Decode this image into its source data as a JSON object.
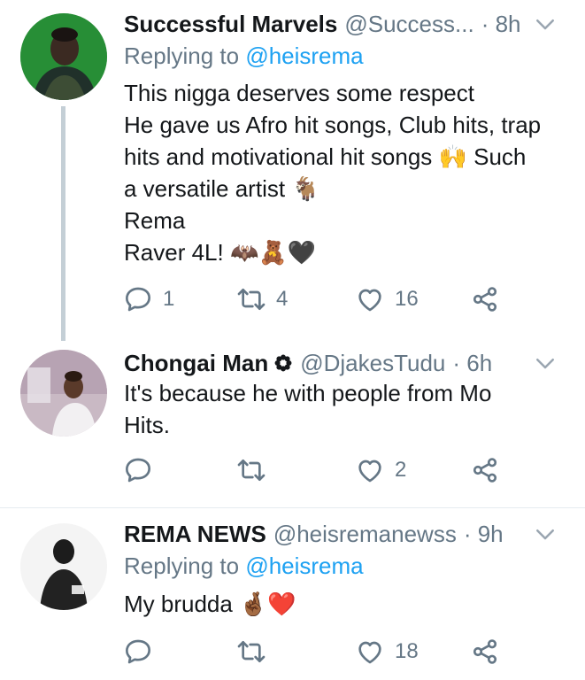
{
  "tweets": [
    {
      "name": "Successful Marvels",
      "handle": "@Success...",
      "time": "· 8h",
      "replying_prefix": "Replying to ",
      "replying_to": "@heisrema",
      "lines": [
        "This nigga deserves some respect",
        "He gave us Afro hit songs, Club hits, trap",
        "hits and motivational hit songs 🙌 Such",
        "a versatile artist 🐐",
        "Rema",
        "Raver 4L! 🦇🧸🖤"
      ],
      "replies": "1",
      "retweets": "4",
      "likes": "16"
    },
    {
      "name": "Chongai Man",
      "badge_icon": "flower-badge-icon",
      "handle": "@DjakesTudu",
      "time": "· 6h",
      "lines": [
        "It's because he with people from Mo",
        "Hits."
      ],
      "replies": "",
      "retweets": "",
      "likes": "2"
    },
    {
      "name": "REMA NEWS",
      "handle": "@heisremanewss",
      "time": "· 9h",
      "replying_prefix": "Replying to ",
      "replying_to": "@heisrema",
      "lines": [
        "My brudda 🤞🏾❤️"
      ],
      "replies": "",
      "retweets": "",
      "likes": "18"
    }
  ],
  "icons": {
    "reply": "reply-icon",
    "retweet": "retweet-icon",
    "like": "heart-icon",
    "share": "share-icon",
    "menu": "chevron-down-icon"
  },
  "colors": {
    "link": "#1da1f2",
    "muted": "#657786",
    "thread_line": "#c4cfd6"
  }
}
